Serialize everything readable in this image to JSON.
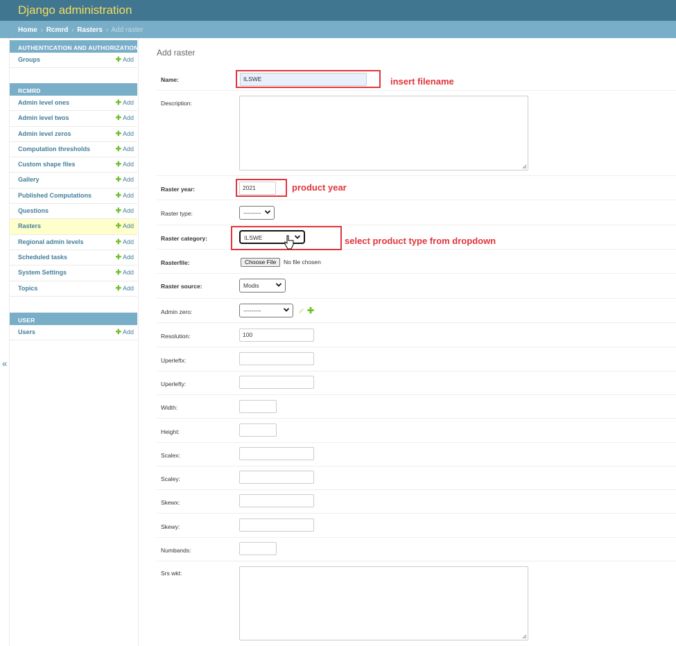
{
  "header": {
    "site_title": "Django administration"
  },
  "breadcrumbs": {
    "items": [
      "Home",
      "Rcmrd",
      "Rasters"
    ],
    "separator": "›",
    "current": "Add raster"
  },
  "sidebar": {
    "collapse_glyph": "«",
    "modules": [
      {
        "caption": "Authentication and Authorization",
        "rows": [
          {
            "label": "Groups",
            "add": "Add"
          }
        ]
      },
      {
        "caption": "RCMRD",
        "rows": [
          {
            "label": "Admin level ones",
            "add": "Add"
          },
          {
            "label": "Admin level twos",
            "add": "Add"
          },
          {
            "label": "Admin level zeros",
            "add": "Add"
          },
          {
            "label": "Computation thresholds",
            "add": "Add"
          },
          {
            "label": "Custom shape files",
            "add": "Add"
          },
          {
            "label": "Gallery",
            "add": "Add"
          },
          {
            "label": "Published Computations",
            "add": "Add"
          },
          {
            "label": "Questions",
            "add": "Add"
          },
          {
            "label": "Rasters",
            "add": "Add",
            "current": true
          },
          {
            "label": "Regional admin levels",
            "add": "Add"
          },
          {
            "label": "Scheduled tasks",
            "add": "Add"
          },
          {
            "label": "System Settings",
            "add": "Add"
          },
          {
            "label": "Topics",
            "add": "Add"
          }
        ]
      },
      {
        "caption": "User",
        "rows": [
          {
            "label": "Users",
            "add": "Add"
          }
        ]
      }
    ]
  },
  "form": {
    "title": "Add raster",
    "name": {
      "label": "Name:",
      "value": "ILSWE"
    },
    "description": {
      "label": "Description:"
    },
    "raster_year": {
      "label": "Raster year:",
      "value": "2021"
    },
    "raster_type": {
      "label": "Raster type:",
      "value": "---------"
    },
    "raster_category": {
      "label": "Raster category:",
      "value": "ILSWE"
    },
    "rasterfile": {
      "label": "Rasterfile:",
      "button": "Choose File",
      "status": "No file chosen"
    },
    "raster_source": {
      "label": "Raster source:",
      "value": "Modis"
    },
    "admin_zero": {
      "label": "Admin zero:",
      "value": "---------"
    },
    "resolution": {
      "label": "Resolution:",
      "value": "100"
    },
    "uperleftx": {
      "label": "Uperleftx:"
    },
    "uperlefty": {
      "label": "Uperlefty:"
    },
    "width": {
      "label": "Width:"
    },
    "height": {
      "label": "Height:"
    },
    "scalex": {
      "label": "Scalex:"
    },
    "scaley": {
      "label": "Scaley:"
    },
    "skewx": {
      "label": "Skewx:"
    },
    "skewy": {
      "label": "Skewy:"
    },
    "numbands": {
      "label": "Numbands:"
    },
    "srs_wkt": {
      "label": "Srs wkt:"
    }
  },
  "annotations": {
    "filename": "insert filename",
    "year": "product year",
    "dropdown": "select product type from dropdown",
    "color": "#e0343a"
  },
  "colors": {
    "header": "#417690",
    "title": "#f5dd5d",
    "breadcrumbs": "#79aec8",
    "link": "#447e9b",
    "add_plus": "#70bf2b",
    "current_row": "#ffffcc"
  }
}
